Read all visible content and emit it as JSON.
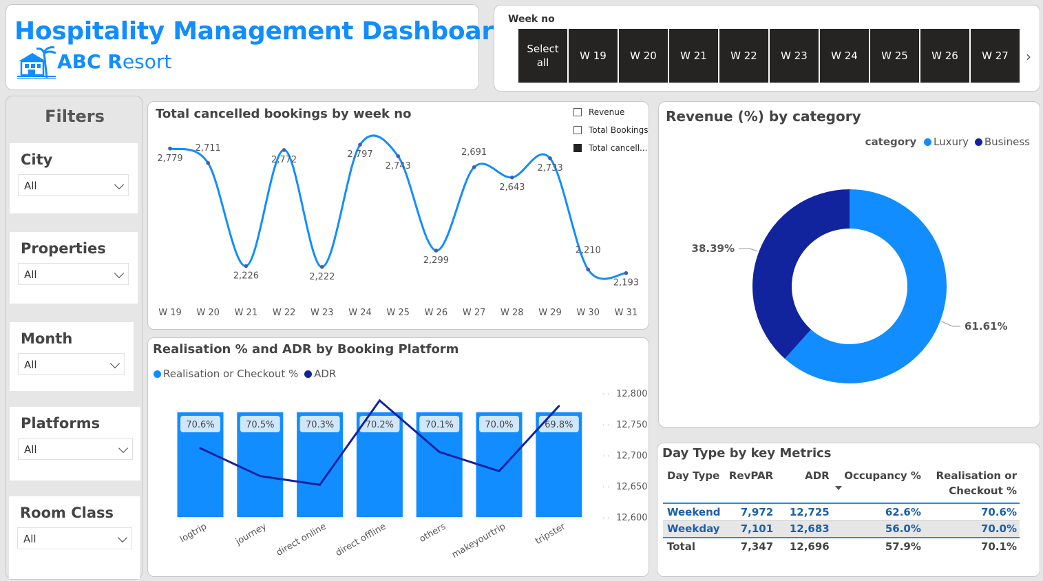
{
  "header": {
    "title": "Hospitality Management Dashboard",
    "subtitle_bold": "ABC R",
    "subtitle_rest": "esort",
    "logo_icon": "resort-building-palm-icon"
  },
  "week_slicer": {
    "label": "Week no",
    "options": [
      "Select all",
      "W 19",
      "W 20",
      "W 21",
      "W 22",
      "W 23",
      "W 24",
      "W 25",
      "W 26",
      "W 27"
    ],
    "next_icon": "chevron-right-icon"
  },
  "filters": {
    "title": "Filters",
    "items": [
      {
        "label": "City",
        "value": "All"
      },
      {
        "label": "Properties",
        "value": "All"
      },
      {
        "label": "Month",
        "value": "All"
      },
      {
        "label": "Platforms",
        "value": "All"
      },
      {
        "label": "Room Class",
        "value": "All"
      }
    ]
  },
  "line_chart": {
    "title": "Total cancelled bookings by week no",
    "legend": [
      "Revenue",
      "Total Bookings",
      "Total cancell..."
    ],
    "legend_checked": [
      false,
      false,
      true
    ],
    "color": "#118dff"
  },
  "combo_chart": {
    "title": "Realisation % and ADR by Booking Platform",
    "legend": [
      "Realisation or Checkout %",
      "ADR"
    ],
    "colors": {
      "bar": "#118dff",
      "line": "#12239e"
    }
  },
  "donut_chart": {
    "title": "Revenue (%) by category",
    "legend_title": "category",
    "legend": [
      "Luxury",
      "Business"
    ],
    "colors": {
      "Luxury": "#118dff",
      "Business": "#12239e"
    }
  },
  "table": {
    "title": "Day Type by key Metrics",
    "headers": [
      "Day Type",
      "RevPAR",
      "ADR",
      "Occupancy %",
      "Realisation or Checkout %"
    ],
    "rows": [
      [
        "Weekend",
        "7,972",
        "12,725",
        "62.6%",
        "70.6%"
      ],
      [
        "Weekday",
        "7,101",
        "12,683",
        "56.0%",
        "70.0%"
      ],
      [
        "Total",
        "7,347",
        "12,696",
        "57.9%",
        "70.1%"
      ]
    ],
    "sort_icon": "sort-descending-icon"
  },
  "chart_data": [
    {
      "type": "line",
      "title": "Total cancelled bookings by week no",
      "categories": [
        "W 19",
        "W 20",
        "W 21",
        "W 22",
        "W 23",
        "W 24",
        "W 25",
        "W 26",
        "W 27",
        "W 28",
        "W 29",
        "W 30",
        "W 31"
      ],
      "series": [
        {
          "name": "Total cancell...",
          "values": [
            2779,
            2711,
            2226,
            2772,
            2222,
            2797,
            2743,
            2299,
            2691,
            2643,
            2733,
            2210,
            2193
          ]
        }
      ],
      "data_labels": [
        "2,779",
        "2,711",
        "2,226",
        "2,772",
        "2,222",
        "2,797",
        "2,743",
        "2,299",
        "2,691",
        "2,643",
        "2,733",
        "2,210",
        "2,193"
      ],
      "ylim": [
        2150,
        2830
      ]
    },
    {
      "type": "bar",
      "title": "Realisation % and ADR by Booking Platform",
      "categories": [
        "logtrip",
        "journey",
        "direct online",
        "direct offline",
        "others",
        "makeyourtrip",
        "tripster"
      ],
      "series": [
        {
          "name": "Realisation or Checkout %",
          "values": [
            70.6,
            70.5,
            70.3,
            70.2,
            70.1,
            70.0,
            69.8
          ],
          "labels": [
            "70.6%",
            "70.5%",
            "70.3%",
            "70.2%",
            "70.1%",
            "70.0%",
            "69.8%"
          ]
        },
        {
          "name": "ADR",
          "type": "line",
          "values": [
            12711,
            12666,
            12652,
            12788,
            12705,
            12674,
            12779
          ]
        }
      ],
      "y2_ticks": [
        "12,800",
        "12,750",
        "12,700",
        "12,650",
        "12,600"
      ],
      "y2lim": [
        12600,
        12800
      ]
    },
    {
      "type": "pie",
      "title": "Revenue (%) by category",
      "categories": [
        "Luxury",
        "Business"
      ],
      "values": [
        61.61,
        38.39
      ],
      "labels": [
        "61.61%",
        "38.39%"
      ]
    }
  ]
}
